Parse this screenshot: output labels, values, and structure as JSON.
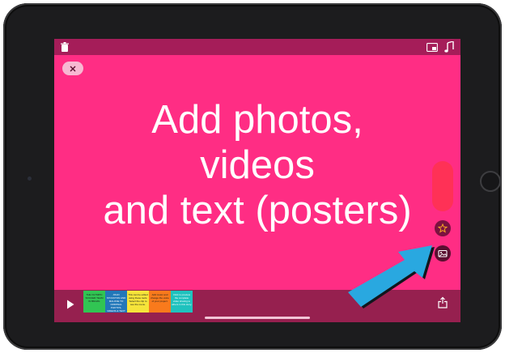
{
  "poster": {
    "line1": "Add photos,",
    "line2": "videos",
    "line3": "and text (posters)"
  },
  "colors": {
    "canvas": "#ff2d84",
    "bars": "#a51d59",
    "bottom_bar": "#96204f",
    "side_pill": "#ff3156",
    "arrow": "#29a8e0"
  },
  "icons": {
    "top_left": "trash-icon",
    "top_right_1": "window-icon",
    "top_right_2": "music-icon",
    "close": "close-icon",
    "star": "star-icon",
    "photo": "photo-icon",
    "play": "play-icon",
    "share": "share-icon"
  },
  "timeline": {
    "clips": [
      {
        "text": "THE OLYMPIC SOCCER TEAM IN BRAZIL",
        "color": "#31c553"
      },
      {
        "text": "JOHN STOCKTON AND MALONE TO CRIMINAL PHOTOS, VIDEOS & TEXT POSTERS",
        "color": "#2177b9"
      },
      {
        "text": "This can be edited using these tools. Select the clip to see the menu.",
        "color": "#f6e43a"
      },
      {
        "text": "Add music and change the voice of your project.",
        "color": "#f97a1c"
      },
      {
        "text": "Click to preview the complete video sharing to others in this story.",
        "color": "#1fc2be"
      }
    ]
  }
}
